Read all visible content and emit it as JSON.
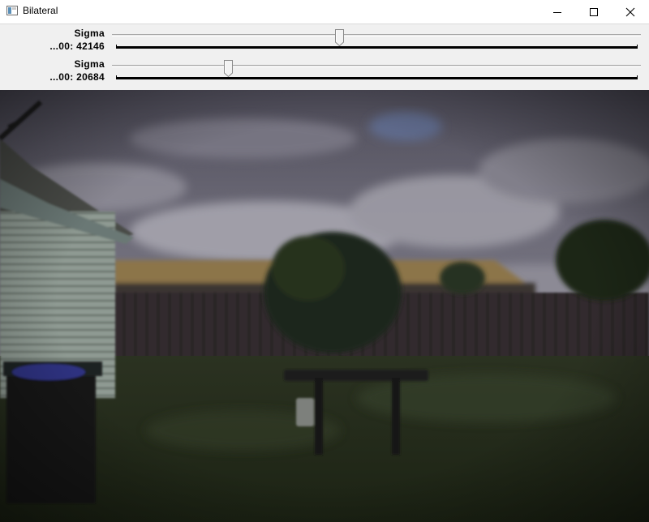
{
  "window": {
    "title": "Bilateral",
    "icon": "app-window-icon",
    "controls": [
      "minimize-icon",
      "maximize-icon",
      "close-icon"
    ]
  },
  "trackbars": [
    {
      "label_line1": "Sigma",
      "label_line2": "...00: 42146",
      "value": 42146,
      "fraction": 0.429
    },
    {
      "label_line1": "Sigma",
      "label_line2": "...00: 20684",
      "value": 20684,
      "fraction": 0.215
    }
  ],
  "colors": {
    "sky": "#6e6b7a",
    "cloud": "#9a98a3",
    "roof": "#8c7448",
    "fence": "#2f2a2c",
    "grass": "#2a3320",
    "house_siding": "#8f9b94"
  }
}
